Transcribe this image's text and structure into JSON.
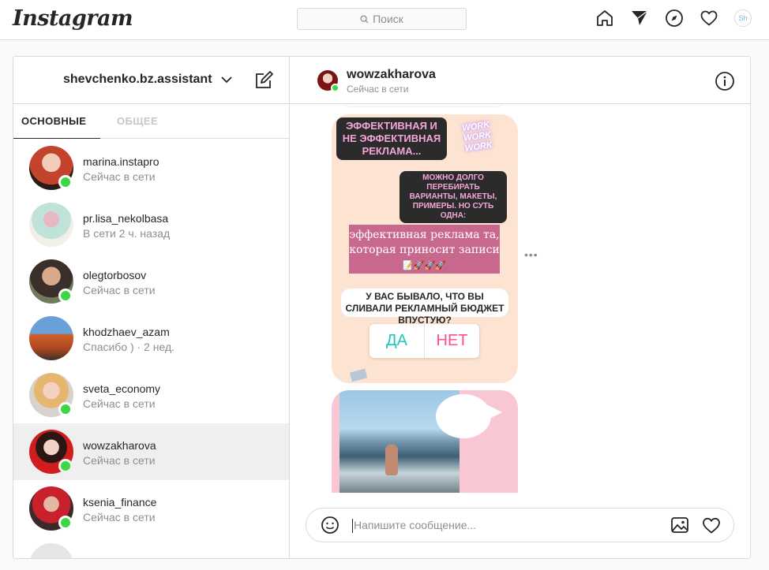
{
  "topnav": {
    "logo": "Instagram",
    "search_placeholder": "Поиск",
    "avatar_initials": "Sh"
  },
  "sidebar": {
    "account_name": "shevchenko.bz.assistant",
    "tabs": [
      {
        "label": "ОСНОВНЫЕ",
        "active": true
      },
      {
        "label": "ОБЩЕЕ",
        "active": false
      }
    ],
    "conversations": [
      {
        "username": "marina.instapro",
        "status": "Сейчас в сети",
        "online": true,
        "selected": false
      },
      {
        "username": "pr.lisa_nekolbasa",
        "status": "В сети 2 ч. назад",
        "online": false,
        "selected": false
      },
      {
        "username": "olegtorbosov",
        "status": "Сейчас в сети",
        "online": true,
        "selected": false
      },
      {
        "username": "khodzhaev_azam",
        "status": "Спасибо ) · 2 нед.",
        "online": false,
        "selected": false
      },
      {
        "username": "sveta_economy",
        "status": "Сейчас в сети",
        "online": true,
        "selected": false
      },
      {
        "username": "wowzakharova",
        "status": "Сейчас в сети",
        "online": true,
        "selected": true
      },
      {
        "username": "ksenia_finance",
        "status": "Сейчас в сети",
        "online": true,
        "selected": false
      }
    ]
  },
  "chat": {
    "username": "wowzakharova",
    "status": "Сейчас в сети",
    "story1": {
      "tag1": "ЭФФЕКТИВНАЯ И НЕ ЭФФЕКТИВНАЯ РЕКЛАМА...",
      "work_sticker": "WORK WORK WORK",
      "tag2": "МОЖНО ДОЛГО ПЕРЕБИРАТЬ ВАРИАНТЫ, МАКЕТЫ, ПРИМЕРЫ. НО СУТЬ ОДНА:",
      "box_text": "эффективная реклама та, которая приносит записи",
      "box_emojis": "📝🚀🚀🚀",
      "question": "У ВАС БЫВАЛО, ЧТО ВЫ СЛИВАЛИ РЕКЛАМНЫЙ БЮДЖЕТ ВПУСТУЮ?",
      "poll_yes": "ДА",
      "poll_no": "НЕТ"
    },
    "more_label": "•••",
    "composer_placeholder": "Напишите сообщение..."
  },
  "colors": {
    "online": "#3cd646",
    "selected_row": "#efefef",
    "story_bg": "#fde3d1",
    "story_pink": "#c9688d"
  }
}
